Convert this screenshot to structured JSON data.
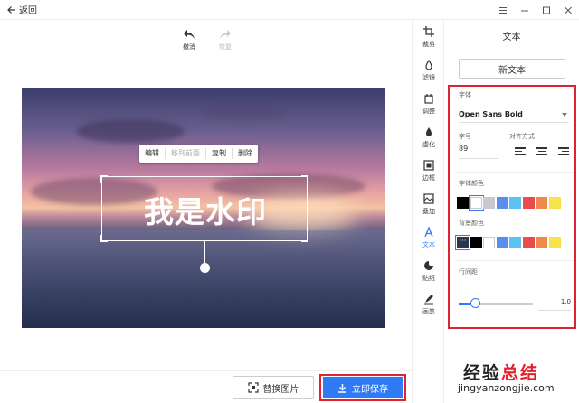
{
  "titlebar": {
    "back_label": "返回"
  },
  "history": {
    "undo_label": "撤消",
    "redo_label": "恢复"
  },
  "context_menu": {
    "edit": "编辑",
    "move_front": "移到前面",
    "copy": "复制",
    "delete": "删除"
  },
  "watermark_text": "我是水印",
  "footer": {
    "replace_label": "替换图片",
    "save_label": "立即保存"
  },
  "tools": [
    {
      "label": "裁剪",
      "icon": "crop-icon"
    },
    {
      "label": "滤镜",
      "icon": "filter-icon"
    },
    {
      "label": "调整",
      "icon": "adjust-icon"
    },
    {
      "label": "虚化",
      "icon": "blur-icon"
    },
    {
      "label": "边框",
      "icon": "border-icon"
    },
    {
      "label": "叠加",
      "icon": "overlay-icon"
    },
    {
      "label": "文本",
      "icon": "text-icon",
      "active": true
    },
    {
      "label": "贴纸",
      "icon": "sticker-icon"
    },
    {
      "label": "画笔",
      "icon": "brush-icon"
    }
  ],
  "panel": {
    "title": "文本",
    "new_text_label": "新文本",
    "font_label": "字体",
    "font_value": "Open Sans Bold",
    "size_label": "字号",
    "size_value": "89",
    "align_label": "对齐方式",
    "font_color_label": "字体颜色",
    "bg_color_label": "背景颜色",
    "line_height_label": "行间距",
    "line_height_value": "1.0",
    "line_height_fraction": 0.22,
    "font_colors": [
      "#000000",
      "#ffffff",
      "#c8c8d0",
      "#5b8def",
      "#5bc2f0",
      "#e84c4c",
      "#f08a4b",
      "#f7e24a"
    ],
    "font_color_selected": 1,
    "bg_colors": [
      "#2a3550",
      "#000000",
      "#ffffff",
      "#5b8def",
      "#5bc2f0",
      "#e84c4c",
      "#f08a4b",
      "#f7e24a"
    ],
    "bg_color_selected": 0
  },
  "site_watermark": {
    "line1_a": "经验",
    "line1_b": "总结",
    "line2": "jingyanzongjie.com"
  },
  "colors": {
    "accent": "#2f7bf5",
    "highlight": "#dd2233"
  }
}
